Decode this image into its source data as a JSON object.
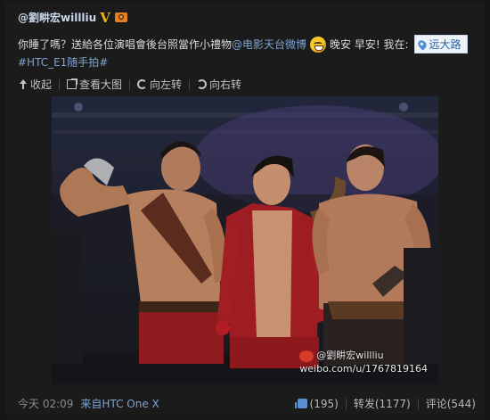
{
  "post": {
    "username": "@劉畊宏willliu",
    "verified_badge": "V",
    "text_before_mention": "你睡了嗎？送給各位演唱會後台照當作小禮物",
    "mention": "@电影天台微博",
    "text_after_emoji": " 晚安 早安! 我在:",
    "location": "远大路",
    "topic": "#HTC_E1随手拍#"
  },
  "toolbar": {
    "collapse_label": "收起",
    "view_large_label": "查看大图",
    "rotate_left_label": "向左转",
    "rotate_right_label": "向右转"
  },
  "photo": {
    "watermark_handle": "@劉畊宏willliu",
    "watermark_url": "weibo.com/u/1767819164"
  },
  "footer": {
    "time": "今天 02:09",
    "source_prefix": "来自",
    "source": "HTC One X",
    "likes": "(195)",
    "repost_label": "转发(1177)",
    "comment_label": "评论(544)"
  },
  "colors": {
    "background": "#161616",
    "link": "#7fa3d2",
    "badge": "#f2b21a"
  },
  "icons": [
    "camera-icon",
    "smile-emoji-icon",
    "location-pin-icon",
    "collapse-icon",
    "view-large-icon",
    "rotate-left-icon",
    "rotate-right-icon",
    "like-icon",
    "weibo-logo-icon"
  ]
}
